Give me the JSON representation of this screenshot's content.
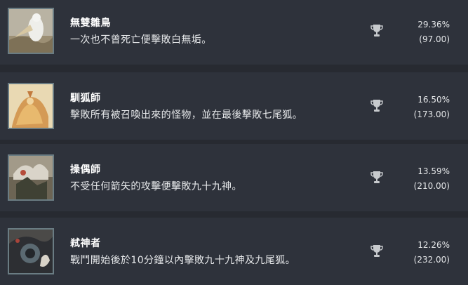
{
  "achievements": [
    {
      "title": "無雙雛鳥",
      "description": "一次也不曾死亡便擊敗白無垢。",
      "percent": "29.36%",
      "points": "(97.00)",
      "icon": "trophy-icon"
    },
    {
      "title": "馴狐師",
      "description": "擊敗所有被召喚出來的怪物，並在最後擊敗七尾狐。",
      "percent": "16.50%",
      "points": "(173.00)",
      "icon": "trophy-icon"
    },
    {
      "title": "操偶師",
      "description": "不受任何箭矢的攻擊便擊敗九十九神。",
      "percent": "13.59%",
      "points": "(210.00)",
      "icon": "trophy-icon"
    },
    {
      "title": "弒神者",
      "description": "戰鬥開始後於10分鐘以內擊敗九十九神及九尾狐。",
      "percent": "12.26%",
      "points": "(232.00)",
      "icon": "trophy-icon"
    }
  ],
  "colors": {
    "background": "#272a31",
    "row": "#2e323b",
    "thumb_border": "#6a7c83",
    "trophy": "#c7cacd"
  }
}
